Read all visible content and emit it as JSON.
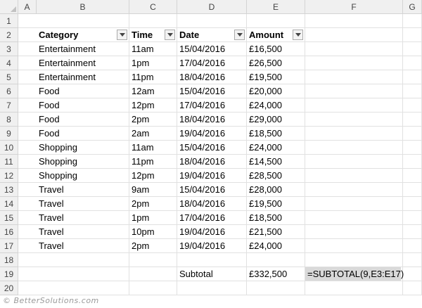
{
  "columns": [
    "A",
    "B",
    "C",
    "D",
    "E",
    "F",
    "G"
  ],
  "rows": [
    "1",
    "2",
    "3",
    "4",
    "5",
    "6",
    "7",
    "8",
    "9",
    "10",
    "11",
    "12",
    "13",
    "14",
    "15",
    "16",
    "17",
    "18",
    "19",
    "20"
  ],
  "table": {
    "headers": [
      "Category",
      "Time",
      "Date",
      "Amount"
    ],
    "rows": [
      [
        "Entertainment",
        "11am",
        "15/04/2016",
        "£16,500"
      ],
      [
        "Entertainment",
        "1pm",
        "17/04/2016",
        "£26,500"
      ],
      [
        "Entertainment",
        "11pm",
        "18/04/2016",
        "£19,500"
      ],
      [
        "Food",
        "12am",
        "15/04/2016",
        "£20,000"
      ],
      [
        "Food",
        "12pm",
        "17/04/2016",
        "£24,000"
      ],
      [
        "Food",
        "2pm",
        "18/04/2016",
        "£29,000"
      ],
      [
        "Food",
        "2am",
        "19/04/2016",
        "£18,500"
      ],
      [
        "Shopping",
        "11am",
        "15/04/2016",
        "£24,000"
      ],
      [
        "Shopping",
        "11pm",
        "18/04/2016",
        "£14,500"
      ],
      [
        "Shopping",
        "12pm",
        "19/04/2016",
        "£28,500"
      ],
      [
        "Travel",
        "9am",
        "15/04/2016",
        "£28,000"
      ],
      [
        "Travel",
        "2pm",
        "18/04/2016",
        "£19,500"
      ],
      [
        "Travel",
        "1pm",
        "17/04/2016",
        "£18,500"
      ],
      [
        "Travel",
        "10pm",
        "19/04/2016",
        "£21,500"
      ],
      [
        "Travel",
        "2pm",
        "19/04/2016",
        "£24,000"
      ]
    ]
  },
  "subtotal": {
    "label": "Subtotal",
    "value": "£332,500",
    "formula": "=SUBTOTAL(9,E3:E17)"
  },
  "footer": "© BetterSolutions.com",
  "colors": {
    "header_bg": "#f0f0f0",
    "grid": "#e1e1e1",
    "formula_highlight": "#d9d9d9"
  }
}
